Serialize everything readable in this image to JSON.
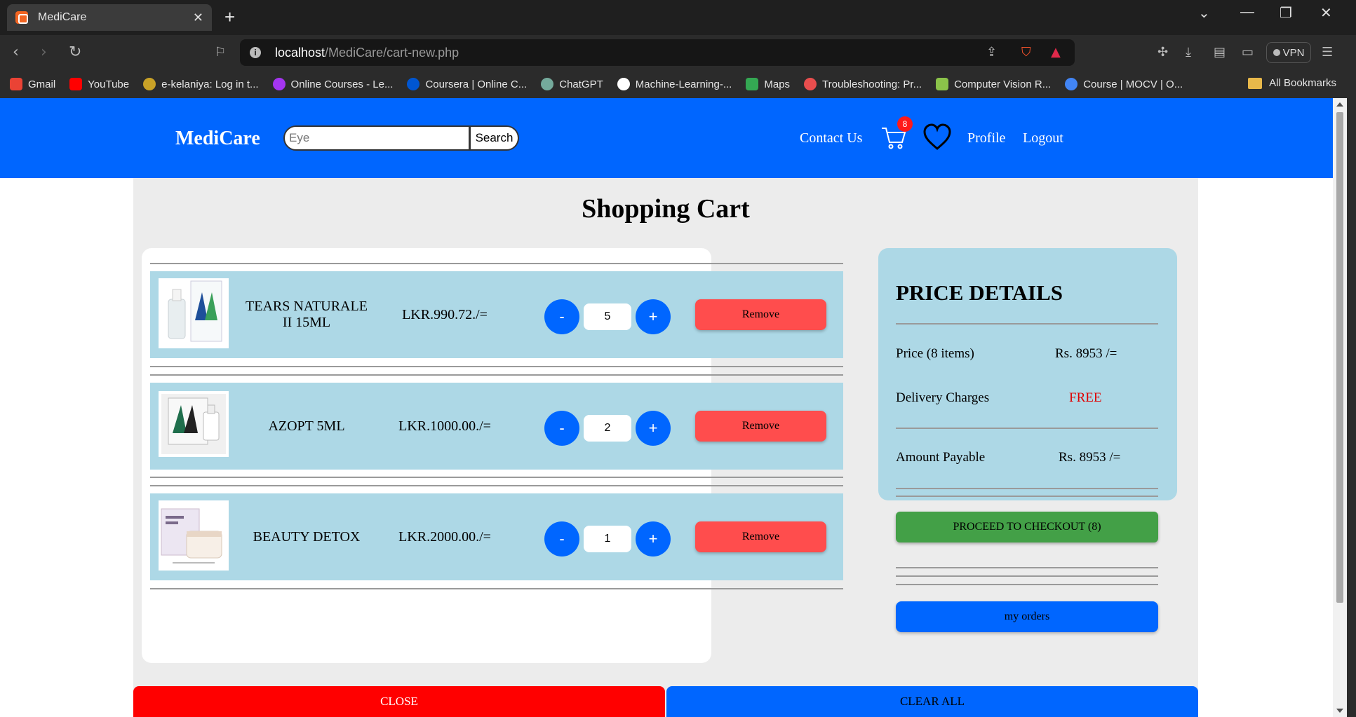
{
  "browser": {
    "tab_title": "MediCare",
    "url_host": "localhost",
    "url_path": "/MediCare/cart-new.php",
    "vpn_label": "VPN",
    "bookmarks": [
      {
        "label": "Gmail",
        "color": "#ea4335"
      },
      {
        "label": "YouTube",
        "color": "#ff0000"
      },
      {
        "label": "e-kelaniya: Log in t...",
        "color": "#c9a227"
      },
      {
        "label": "Online Courses - Le...",
        "color": "#a435f0"
      },
      {
        "label": "Coursera | Online C...",
        "color": "#0056d2"
      },
      {
        "label": "ChatGPT",
        "color": "#74aa9c"
      },
      {
        "label": "Machine-Learning-...",
        "color": "#ffffff"
      },
      {
        "label": "Maps",
        "color": "#34a853"
      },
      {
        "label": "Troubleshooting: Pr...",
        "color": "#e94e4e"
      },
      {
        "label": "Computer Vision R...",
        "color": "#8bc34a"
      },
      {
        "label": "Course | MOCV | O...",
        "color": "#4285f4"
      }
    ],
    "all_bookmarks": "All Bookmarks"
  },
  "header": {
    "brand": "MediCare",
    "search_value": "",
    "search_placeholder": "Eye",
    "search_button": "Search",
    "contact": "Contact Us",
    "cart_count": "8",
    "profile": "Profile",
    "logout": "Logout"
  },
  "cart": {
    "title": "Shopping Cart",
    "items": [
      {
        "name": "TEARS NATURALE II 15ML",
        "price": "LKR.990.72./=",
        "qty": "5",
        "minus": "-",
        "plus": "+",
        "remove": "Remove"
      },
      {
        "name": "AZOPT 5ML",
        "price": "LKR.1000.00./=",
        "qty": "2",
        "minus": "-",
        "plus": "+",
        "remove": "Remove"
      },
      {
        "name": "BEAUTY DETOX",
        "price": "LKR.2000.00./=",
        "qty": "1",
        "minus": "-",
        "plus": "+",
        "remove": "Remove"
      }
    ]
  },
  "price_details": {
    "title": "PRICE DETAILS",
    "price_label": "Price (8 items)",
    "price_value": "Rs. 8953 /=",
    "delivery_label": "Delivery Charges",
    "delivery_value": "FREE",
    "payable_label": "Amount Payable",
    "payable_value": "Rs. 8953 /=",
    "checkout": "PROCEED TO CHECKOUT (8)",
    "my_orders": "my orders"
  },
  "footer_buttons": {
    "close": "CLOSE",
    "clear_all": "CLEAR ALL"
  },
  "colors": {
    "header_blue": "#0066ff",
    "item_bg": "#add8e6",
    "remove_red": "#ff4d4d",
    "checkout_green": "#43a047",
    "free_red": "#e00000"
  }
}
